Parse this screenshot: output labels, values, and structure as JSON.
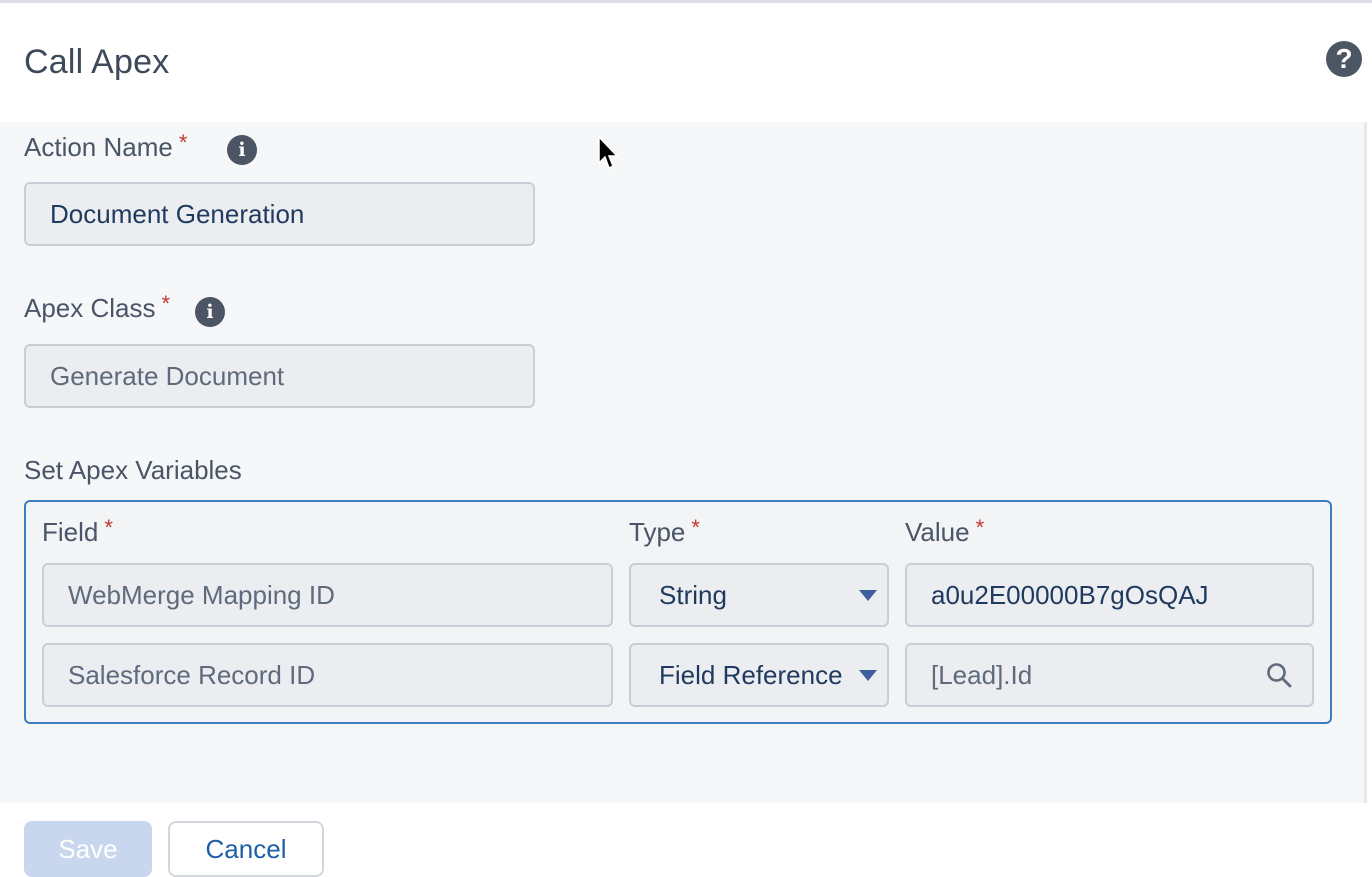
{
  "header": {
    "title": "Call Apex"
  },
  "form": {
    "action_name": {
      "label": "Action Name",
      "required_mark": "*",
      "value": "Document Generation"
    },
    "apex_class": {
      "label": "Apex Class",
      "required_mark": "*",
      "value": "Generate Document"
    },
    "apex_variables": {
      "section_label": "Set Apex Variables",
      "columns": {
        "field": "Field",
        "type": "Type",
        "value": "Value",
        "required_mark": "*"
      },
      "rows": [
        {
          "field": "WebMerge Mapping ID",
          "type": "String",
          "value": "a0u2E00000B7gOsQAJ"
        },
        {
          "field": "Salesforce Record ID",
          "type": "Field Reference",
          "value": "[Lead].Id"
        }
      ]
    }
  },
  "footer": {
    "save_label": "Save",
    "cancel_label": "Cancel"
  },
  "icons": {
    "help": "help-icon",
    "info": "info-icon",
    "search": "search-icon",
    "caret": "chevron-down-icon"
  },
  "colors": {
    "required": "#c23934",
    "focus_border": "#3f7fbf",
    "save_disabled": "#c9d7ee"
  }
}
